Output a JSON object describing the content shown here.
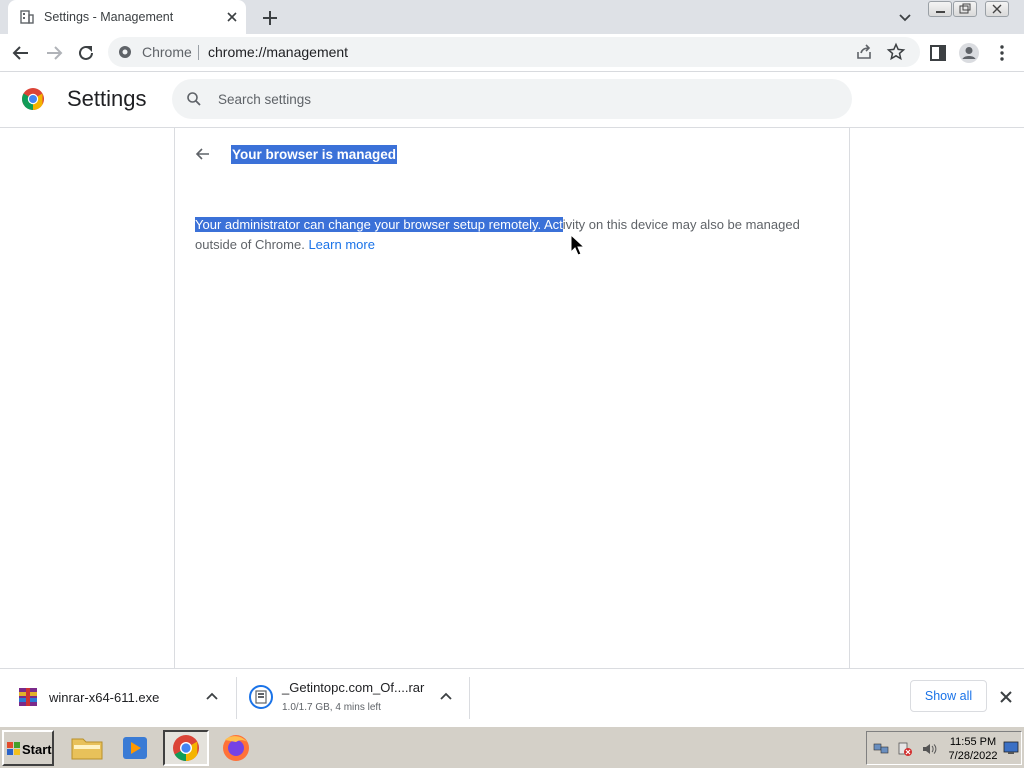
{
  "tab": {
    "title": "Settings - Management",
    "favicon": "building-icon"
  },
  "toolbar": {
    "omnibox_chip": "Chrome",
    "url": "chrome://management"
  },
  "header": {
    "title": "Settings",
    "search_placeholder": "Search settings"
  },
  "management": {
    "title": "Your browser is managed",
    "message_selected": "Your administrator can change your browser setup remotely. Act",
    "message_rest": "ivity on this device may also be managed outside of Chrome. ",
    "learn_more": "Learn more"
  },
  "downloads": {
    "items": [
      {
        "name": "winrar-x64-611.exe",
        "status": "",
        "icon": "winrar-icon"
      },
      {
        "name": "_Getintopc.com_Of....rar",
        "status": "1.0/1.7 GB, 4 mins left",
        "icon": "rar-archive-icon"
      }
    ],
    "show_all": "Show all"
  },
  "taskbar": {
    "start_label": "Start",
    "apps": [
      "file-explorer-icon",
      "media-player-icon",
      "chrome-icon",
      "firefox-icon"
    ],
    "clock_time": "11:55 PM",
    "clock_date": "7/28/2022"
  },
  "colors": {
    "selection": "#3b71d8",
    "link": "#1a73e8",
    "tabstrip": "#dee1e6",
    "taskbar": "#d4d0c8"
  }
}
